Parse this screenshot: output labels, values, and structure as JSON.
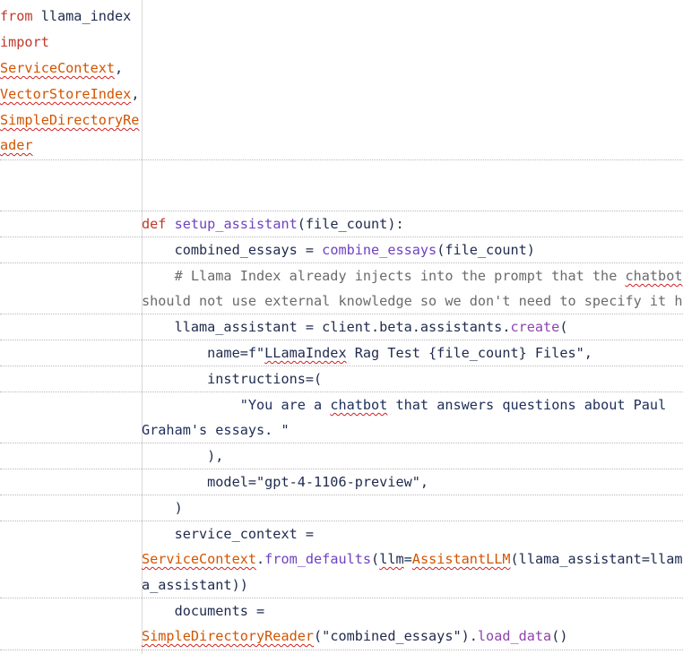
{
  "code": {
    "import_block": {
      "from_kw": "from",
      "module": " llama_index",
      "import_kw": "import",
      "item1": "ServiceContext",
      "item1_sep": ",",
      "item2": "VectorStoreIndex",
      "item2_sep": ",",
      "item3_a": "SimpleDirectoryRe",
      "item3_b": "ader"
    },
    "def_kw": "def",
    "def_space": " ",
    "def_name": "setup_assistant",
    "def_rest": "(file_count):",
    "l_combined_pre": "    combined_essays = ",
    "l_combined_fn": "combine_essays",
    "l_combined_post": "(file_count)",
    "comment_1": "    # Llama Index already injects into the prompt that the ",
    "comment_chatbot": "chatbot",
    "comment_2": "should not use external knowledge so we don't need to specify it here.",
    "l_assistant_pre": "    llama_assistant = client.beta.assistants.",
    "l_assistant_fn": "create",
    "l_assistant_post": "(",
    "name_pre": "        name=f\"",
    "name_sq": "LLamaIndex",
    "name_post": " Rag Test {file_count} Files\",",
    "instructions_line": "        instructions=(",
    "str_pre": "            \"You are a ",
    "str_sq": "chatbot",
    "str_post": " that answers questions about Paul",
    "str_cont": "Graham's essays. \"",
    "close_paren_comma": "        ),",
    "model_line": "        model=\"gpt-4-1106-preview\",",
    "close_paren": "    )",
    "service_line": "    service_context =",
    "sc_cls": "ServiceContext",
    "sc_dot": ".",
    "sc_fn": "from_defaults",
    "sc_open": "(",
    "sc_llm": "llm",
    "sc_eq": "=",
    "sc_llmcls": "AssistantLLM",
    "sc_rest": "(llama_assistant=llam",
    "sc_cont": "a_assistant))",
    "documents_line": "    documents =",
    "docs_cls": "SimpleDirectoryReader",
    "docs_arg": "(\"combined_essays\").",
    "docs_fn": "load_data",
    "docs_end": "()"
  }
}
